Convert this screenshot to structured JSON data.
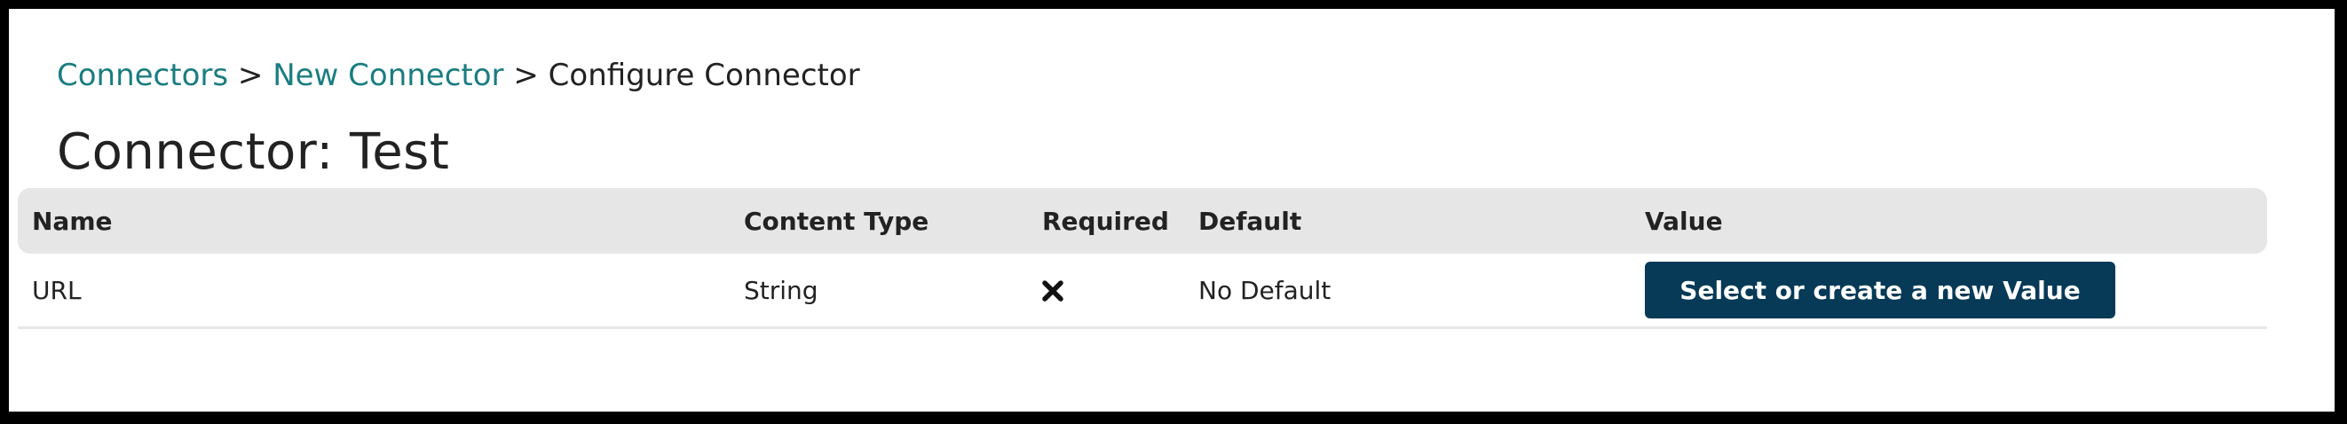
{
  "breadcrumb": {
    "items": [
      {
        "label": "Connectors",
        "link": true
      },
      {
        "label": "New Connector",
        "link": true
      },
      {
        "label": "Configure Connector",
        "link": false
      }
    ],
    "separator": ">"
  },
  "page": {
    "title": "Connector: Test"
  },
  "table": {
    "headers": [
      "Name",
      "Content Type",
      "Required",
      "Default",
      "Value"
    ],
    "rows": [
      {
        "name": "URL",
        "content_type": "String",
        "required_icon": "cross-icon",
        "default": "No Default",
        "value_button_label": "Select or create a new Value"
      }
    ]
  },
  "colors": {
    "link": "#1a7d80",
    "button_bg": "#063a56",
    "header_bg": "#e6e6e6",
    "text": "#222222"
  }
}
